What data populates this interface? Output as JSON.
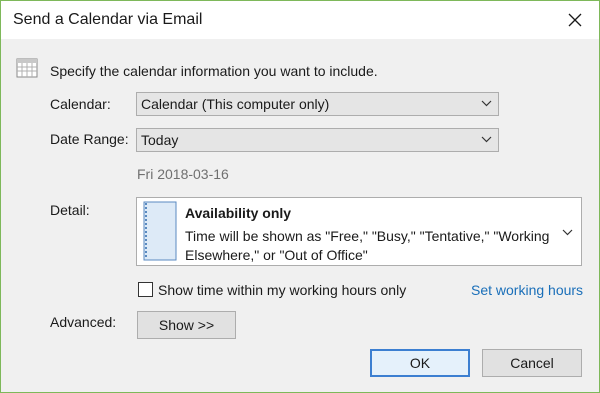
{
  "window": {
    "title": "Send a Calendar via Email",
    "close_icon": "close-icon"
  },
  "intro": {
    "icon": "calendar-icon",
    "text": "Specify the calendar information you want to include."
  },
  "calendar": {
    "label": "Calendar:",
    "value": "Calendar (This computer only)"
  },
  "date_range": {
    "label": "Date Range:",
    "value": "Today",
    "date": "Fri 2018-03-16"
  },
  "detail": {
    "label": "Detail:",
    "title": "Availability only",
    "description": "Time will be shown as \"Free,\" \"Busy,\" \"Tentative,\" \"Working Elsewhere,\" or \"Out of Office\""
  },
  "working_hours": {
    "checkbox_label": "Show time within my working hours only",
    "checked": false,
    "link": "Set working hours"
  },
  "advanced": {
    "label": "Advanced:",
    "button": "Show >>"
  },
  "buttons": {
    "ok": "OK",
    "cancel": "Cancel"
  },
  "colors": {
    "window_border": "#7eb85a",
    "link": "#1a6fb9",
    "default_button_border": "#3c7fd1"
  }
}
